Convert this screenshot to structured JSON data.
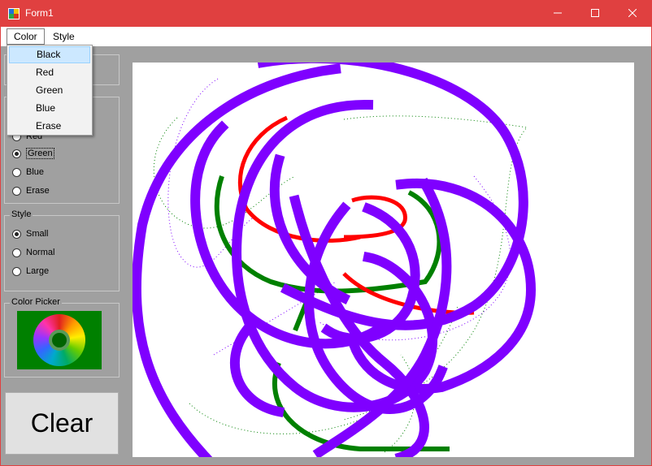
{
  "window": {
    "title": "Form1"
  },
  "titlebar_buttons": {
    "minimize": "—",
    "maximize": "☐",
    "close": "✕"
  },
  "menubar": {
    "color_label": "Color",
    "style_label": "Style"
  },
  "color_menu": [
    {
      "label": "Black",
      "highlighted": true
    },
    {
      "label": "Red"
    },
    {
      "label": "Green"
    },
    {
      "label": "Blue"
    },
    {
      "label": "Erase"
    }
  ],
  "color_group": {
    "partial_label": "Red",
    "options": [
      {
        "label": "Green",
        "checked": true
      },
      {
        "label": "Blue"
      },
      {
        "label": "Erase"
      }
    ]
  },
  "style_group": {
    "title": "Style",
    "options": [
      {
        "label": "Small",
        "checked": true
      },
      {
        "label": "Normal"
      },
      {
        "label": "Large"
      }
    ]
  },
  "color_picker": {
    "title": "Color Picker"
  },
  "clear_button": {
    "label": "Clear"
  },
  "colors": {
    "titlebar": "#e04040",
    "stroke_purple": "#7f00ff",
    "stroke_red": "#ff0000",
    "stroke_green": "#008000",
    "picker_bg": "#008000"
  }
}
